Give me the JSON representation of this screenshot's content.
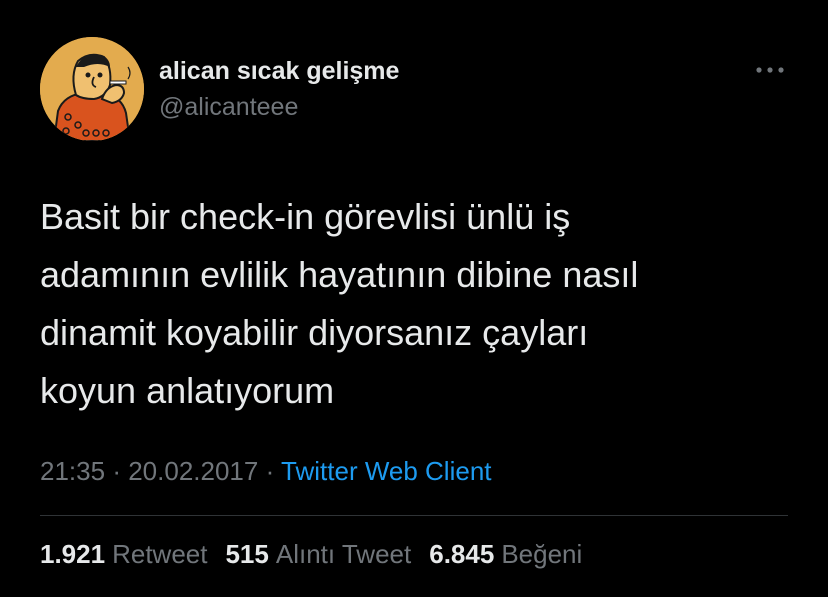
{
  "author": {
    "display_name": "alican sıcak gelişme",
    "handle": "@alicanteee",
    "avatar_icon": "cartoon-man-smoking-avatar-icon"
  },
  "tweet": {
    "text_lines": [
      "Basit bir check-in görevlisi ünlü iş",
      "adamının evlilik hayatının dibine nasıl",
      "dinamit koyabilir diyorsanız çayları",
      "koyun anlatıyorum"
    ],
    "time": "21:35",
    "date": "20.02.2017",
    "source": "Twitter Web Client",
    "separator": "·"
  },
  "stats": {
    "retweets": {
      "count": "1.921",
      "label": "Retweet"
    },
    "quotes": {
      "count": "515",
      "label": "Alıntı Tweet"
    },
    "likes": {
      "count": "6.845",
      "label": "Beğeni"
    }
  },
  "icons": {
    "more": "more-horizontal-icon"
  },
  "colors": {
    "background": "#000000",
    "primary_text": "#e7e9ea",
    "secondary_text": "#71767b",
    "link": "#1d9bf0",
    "divider": "#2f3336",
    "avatar_bg": "#e3ab4e"
  }
}
